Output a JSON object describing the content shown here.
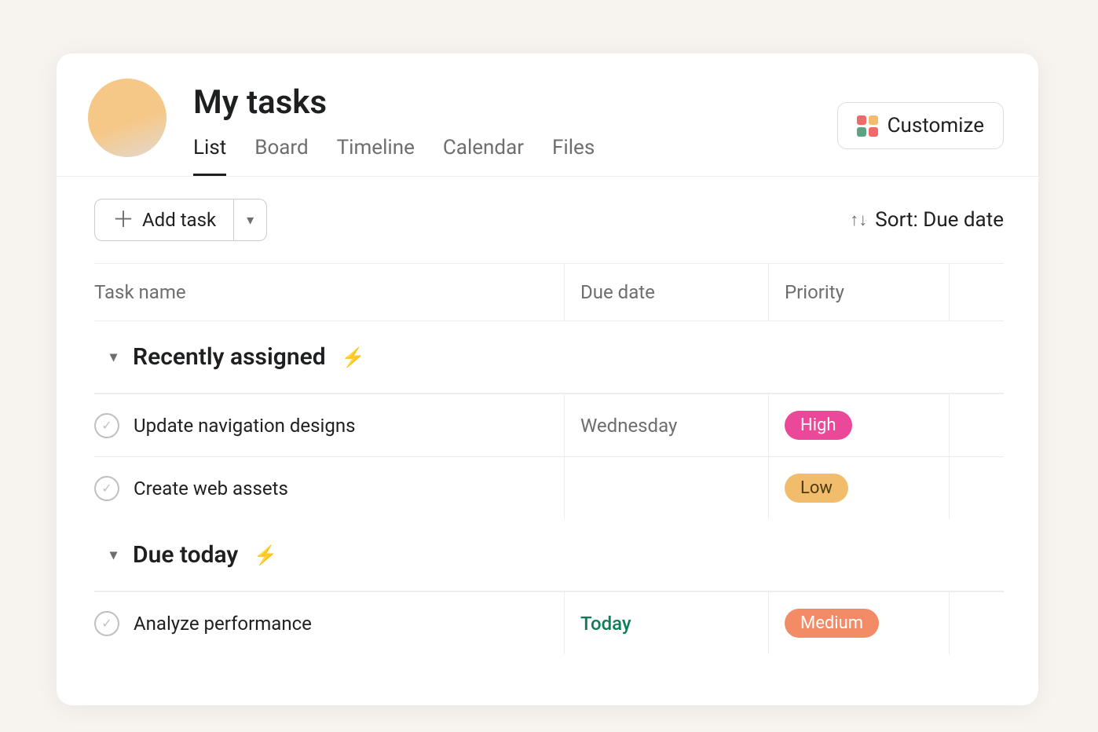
{
  "header": {
    "title": "My tasks",
    "tabs": [
      "List",
      "Board",
      "Timeline",
      "Calendar",
      "Files"
    ],
    "active_tab": 0,
    "customize_label": "Customize"
  },
  "toolbar": {
    "add_task_label": "Add task",
    "sort_label": "Sort: Due date"
  },
  "columns": [
    "Task name",
    "Due date",
    "Priority"
  ],
  "sections": [
    {
      "title": "Recently assigned",
      "tasks": [
        {
          "name": "Update navigation designs",
          "due": "Wednesday",
          "due_style": "normal",
          "priority": "High",
          "priority_style": "high"
        },
        {
          "name": "Create web assets",
          "due": "",
          "due_style": "normal",
          "priority": "Low",
          "priority_style": "low"
        }
      ]
    },
    {
      "title": "Due today",
      "tasks": [
        {
          "name": "Analyze performance",
          "due": "Today",
          "due_style": "today",
          "priority": "Medium",
          "priority_style": "medium"
        }
      ]
    }
  ]
}
